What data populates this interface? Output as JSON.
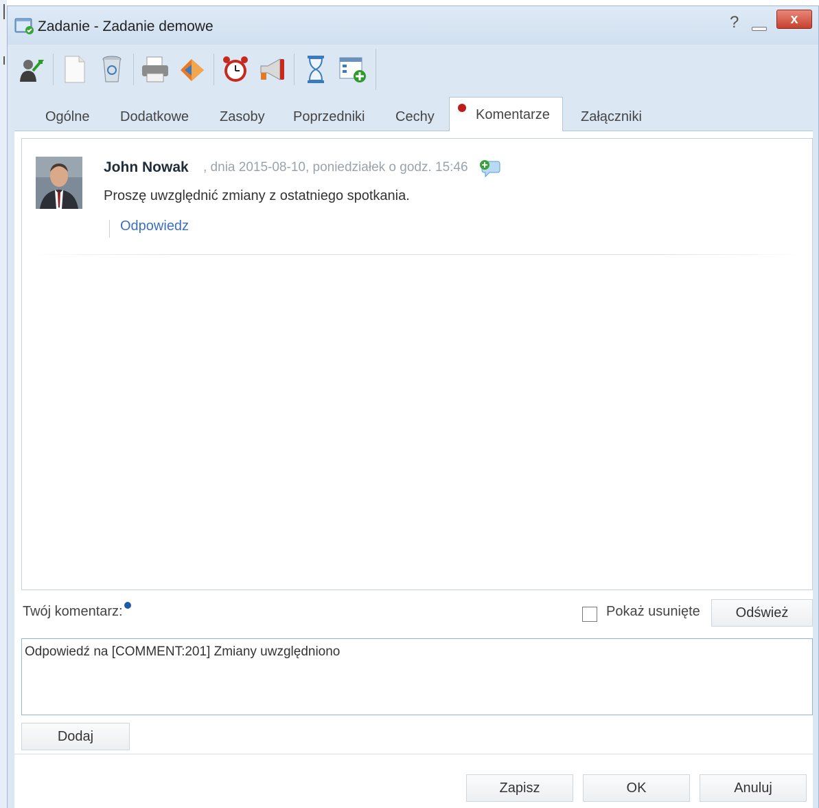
{
  "window": {
    "title": "Zadanie - Zadanie demowe",
    "help_symbol": "?",
    "close_symbol": "x"
  },
  "toolbar": {
    "icons": [
      "user-assign-icon",
      "new-document-icon",
      "recycle-bin-icon",
      "print-icon",
      "chart-icon",
      "alarm-clock-icon",
      "megaphone-icon",
      "hourglass-icon",
      "add-view-icon"
    ]
  },
  "tabs": [
    {
      "label": "Ogólne"
    },
    {
      "label": "Dodatkowe"
    },
    {
      "label": "Zasoby"
    },
    {
      "label": "Poprzedniki"
    },
    {
      "label": "Cechy"
    },
    {
      "label": "Komentarze",
      "active": true,
      "alert": true
    },
    {
      "label": "Załączniki"
    }
  ],
  "comments": [
    {
      "author": "John Nowak",
      "meta": ", dnia 2015-08-10, poniedziałek o godz. 15:46",
      "text": "Proszę uwzględnić zmiany z ostatniego spotkania.",
      "reply_label": "Odpowiedz"
    }
  ],
  "form": {
    "label": "Twój komentarz:",
    "show_deleted_label": "Pokaż usunięte",
    "show_deleted_checked": false,
    "refresh_label": "Odśwież",
    "input_value": "Odpowiedź na [COMMENT:201] Zmiany uwzględniono",
    "add_label": "Dodaj"
  },
  "footer": {
    "save_label": "Zapisz",
    "ok_label": "OK",
    "cancel_label": "Anuluj"
  },
  "colors": {
    "link": "#3b6fbf",
    "alert": "#c01a1a",
    "close_button": "#c6412f"
  }
}
